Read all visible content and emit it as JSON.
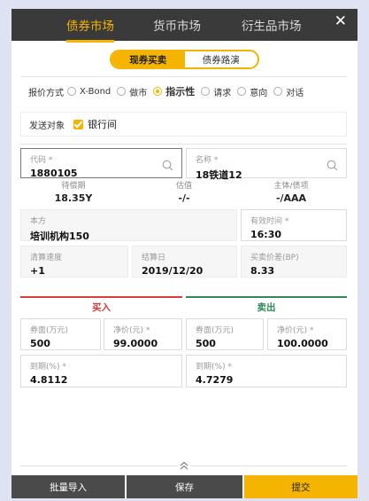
{
  "top_tabs": [
    "债券市场",
    "货币市场",
    "衍生品市场"
  ],
  "close_label": "✕",
  "segment": [
    "现券买卖",
    "债券路演"
  ],
  "quote": {
    "label": "报价方式",
    "options": [
      "X-Bond",
      "做市",
      "指示性",
      "请求",
      "意向",
      "对话"
    ],
    "selected": "指示性"
  },
  "send_target": {
    "label": "发送对象",
    "checkbox_label": "银行间",
    "checked": true
  },
  "code": {
    "label": "代码 *",
    "value": "1880105"
  },
  "name": {
    "label": "名称 *",
    "value": "18铁道12"
  },
  "info": [
    {
      "label": "待偿期",
      "value": "18.35Y"
    },
    {
      "label": "估值",
      "value": "-/-"
    },
    {
      "label": "主体/债项",
      "value": "-/AAA"
    }
  ],
  "party": {
    "label": "本方",
    "value": "培训机构150"
  },
  "valid_time": {
    "label": "有效时间 *",
    "value": "16:30"
  },
  "clearing_speed": {
    "label": "清算速度",
    "value": "+1"
  },
  "settle_date": {
    "label": "结算日",
    "value": "2019/12/20"
  },
  "bid_ask_spread": {
    "label": "买卖价差(BP)",
    "value": "8.33"
  },
  "buy": {
    "title": "买入",
    "face": {
      "label": "券面(万元)",
      "value": "500"
    },
    "price": {
      "label": "净价(元) *",
      "value": "99.0000"
    },
    "ytm": {
      "label": "到期(%) *",
      "value": "4.8112"
    }
  },
  "sell": {
    "title": "卖出",
    "face": {
      "label": "券面(万元)",
      "value": "500"
    },
    "price": {
      "label": "净价(元) *",
      "value": "100.0000"
    },
    "ytm": {
      "label": "到期(%) *",
      "value": "4.7279"
    }
  },
  "footer": [
    "批量导入",
    "保存",
    "提交"
  ],
  "colors": {
    "accent": "#f5b400",
    "header": "#3a3a3a",
    "buy": "#d93a3a",
    "sell": "#2b8a55"
  }
}
